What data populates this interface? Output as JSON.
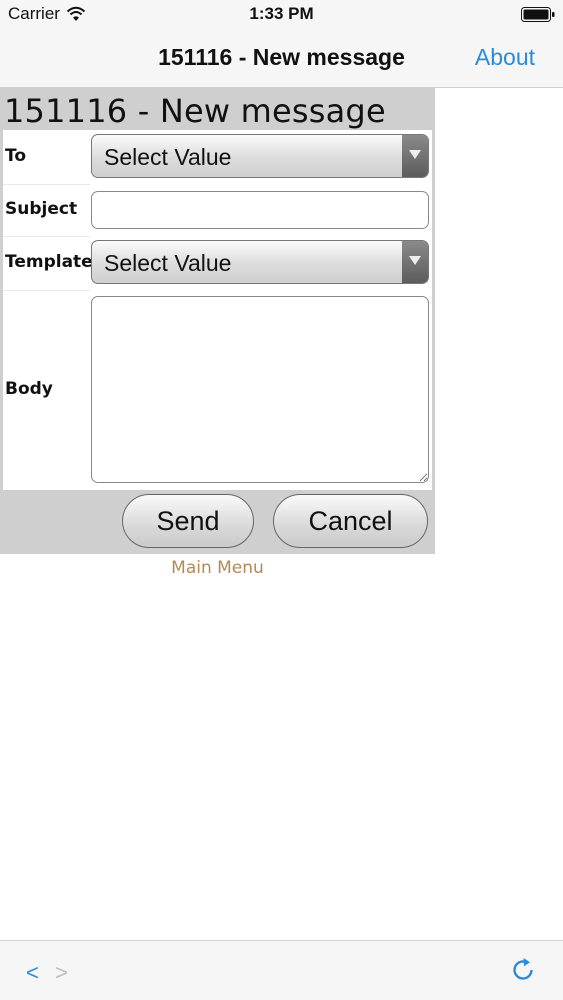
{
  "status_bar": {
    "carrier": "Carrier",
    "time": "1:33 PM"
  },
  "nav": {
    "title": "151116 - New message",
    "about_label": "About"
  },
  "page": {
    "heading": "151116 - New message",
    "fields": {
      "to_label": "To",
      "to_value": "Select Value",
      "subject_label": "Subject",
      "subject_value": "",
      "template_label": "Template",
      "template_value": "Select Value",
      "body_label": "Body",
      "body_value": ""
    },
    "buttons": {
      "send": "Send",
      "cancel": "Cancel"
    },
    "main_menu": "Main Menu"
  },
  "toolbar": {
    "back": "<",
    "forward": ">"
  },
  "colors": {
    "link": "#2b8bd8",
    "main_menu": "#b28a55",
    "panel": "#cfcfcf"
  },
  "icons": [
    "wifi-icon",
    "battery-icon",
    "chevron-down-icon",
    "back-icon",
    "forward-icon",
    "refresh-icon"
  ]
}
